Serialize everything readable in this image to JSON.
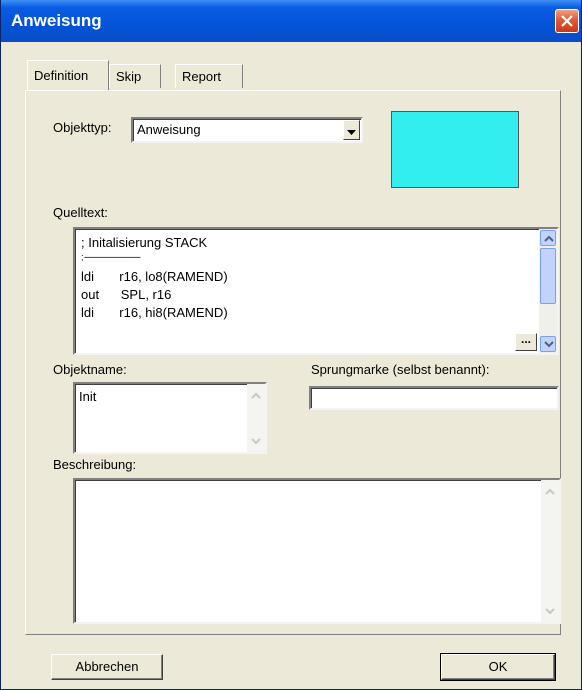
{
  "window": {
    "title": "Anweisung"
  },
  "tabs": [
    {
      "label": "Definition",
      "active": true
    },
    {
      "label": "Skip",
      "active": false
    },
    {
      "label": "Report",
      "active": false
    }
  ],
  "form": {
    "objekttyp_label": "Objekttyp:",
    "objekttyp_value": "Anweisung",
    "color_swatch": "#33eeee",
    "quelltext_label": "Quelltext:",
    "quelltext_lines": [
      "; Initalisierung STACK",
      "; ----------------------------",
      "ldi       r16, lo8(RAMEND)",
      "out      SPL, r16",
      "ldi       r16, hi8(RAMEND)"
    ],
    "ellipsis_label": "...",
    "objektname_label": "Objektname:",
    "objektname_value": "Init",
    "sprungmarke_label": "Sprungmarke (selbst benannt):",
    "sprungmarke_value": "",
    "beschreibung_label": "Beschreibung:",
    "beschreibung_value": ""
  },
  "buttons": {
    "cancel_label": "Abbrechen",
    "ok_label": "OK"
  }
}
